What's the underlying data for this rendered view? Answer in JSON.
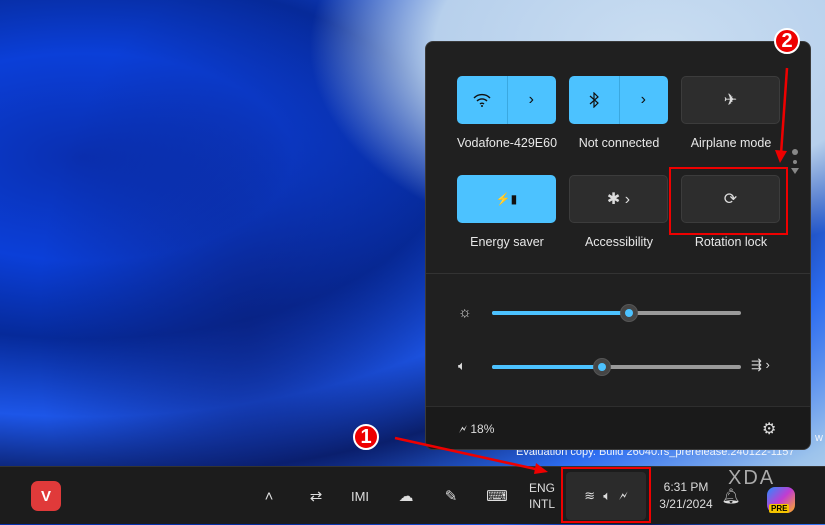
{
  "quick_settings": {
    "tiles": [
      {
        "label": "Vodafone-429E60",
        "icon": "wifi-icon",
        "active": true
      },
      {
        "label": "Not connected",
        "icon": "bluetooth-icon",
        "active": true
      },
      {
        "label": "Airplane mode",
        "icon": "airplane-icon",
        "active": false
      },
      {
        "label": "Energy saver",
        "icon": "energy-saver-icon",
        "active": true
      },
      {
        "label": "Accessibility",
        "icon": "accessibility-icon",
        "active": false
      },
      {
        "label": "Rotation lock",
        "icon": "rotation-lock-icon",
        "active": false
      }
    ],
    "brightness_percent": 55,
    "volume_percent": 44,
    "battery": "18%"
  },
  "watermark": {
    "line1": "w",
    "line2": "Evaluation copy. Build 26040.rs_prerelease.240122-1157"
  },
  "taskbar": {
    "lang1": "ENG",
    "lang2": "INTL",
    "time": "6:31 PM",
    "date": "3/21/2024",
    "copilot_badge": "PRE",
    "brand": "XDA"
  },
  "annotations": [
    "1",
    "2"
  ],
  "colors": {
    "accent": "#4cc2ff",
    "annotation": "#e00000"
  }
}
